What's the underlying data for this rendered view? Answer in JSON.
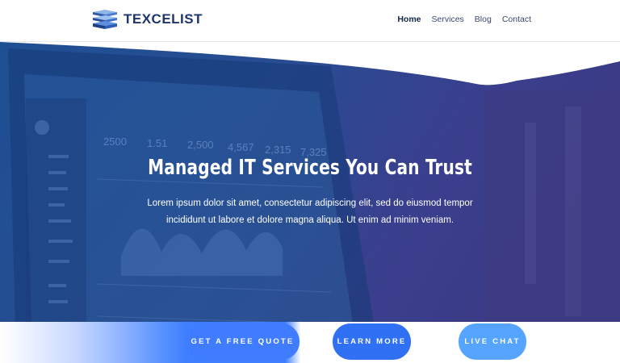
{
  "brand": {
    "name": "TEXCELIST",
    "logo_icon": "stacked-layers-icon",
    "colors": {
      "primary": "#1f3570",
      "accent": "#3f7cff",
      "light_accent": "#55a4ff"
    }
  },
  "nav": {
    "items": [
      {
        "label": "Home",
        "active": true
      },
      {
        "label": "Services",
        "active": false
      },
      {
        "label": "Blog",
        "active": false
      },
      {
        "label": "Contact",
        "active": false
      }
    ]
  },
  "hero": {
    "title": "Managed IT Services You Can Trust",
    "text": "Lorem ipsum dolor sit amet, consectetur adipiscing elit, sed do eiusmod tempor incididunt ut labore et dolore magna aliqua. Ut enim ad minim veniam."
  },
  "cta": {
    "quote": "GET A FREE QUOTE",
    "learn": "LEARN MORE",
    "chat": "LIVE CHAT"
  }
}
